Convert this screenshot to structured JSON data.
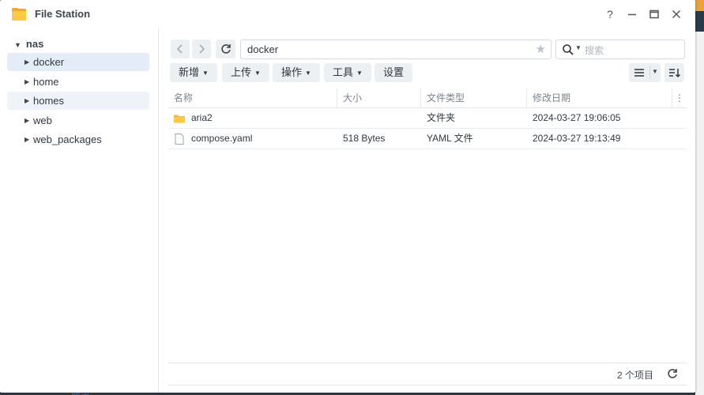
{
  "window": {
    "title": "File Station"
  },
  "tree": {
    "root": "nas",
    "items": [
      {
        "label": "docker"
      },
      {
        "label": "home"
      },
      {
        "label": "homes"
      },
      {
        "label": "web"
      },
      {
        "label": "web_packages"
      }
    ]
  },
  "toolbar": {
    "path": "docker",
    "search_placeholder": "搜索",
    "buttons": [
      "新增",
      "上传",
      "操作",
      "工具",
      "设置"
    ]
  },
  "table": {
    "columns": [
      "名称",
      "大小",
      "文件类型",
      "修改日期"
    ],
    "rows": [
      {
        "name": "aria2",
        "size": "",
        "type": "文件夹",
        "modified": "2024-03-27 19:06:05",
        "icon": "folder-icon"
      },
      {
        "name": "compose.yaml",
        "size": "518 Bytes",
        "type": "YAML 文件",
        "modified": "2024-03-27 19:13:49",
        "icon": "file-icon"
      }
    ]
  },
  "status": {
    "count": "2 个项目"
  },
  "background": {
    "link_text": "服务"
  },
  "colors": {
    "accent": "#e3ecf7",
    "folder": "#f5b82e"
  }
}
